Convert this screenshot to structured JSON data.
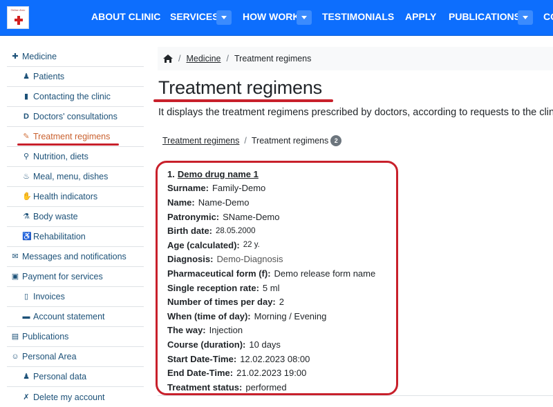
{
  "navbar": {
    "logo_text": "Online clinic",
    "items": [
      {
        "label": "ABOUT CLINIC",
        "has_dropdown": false
      },
      {
        "label": "SERVICES",
        "has_dropdown": true
      },
      {
        "label": "HOW WORK",
        "has_dropdown": true
      },
      {
        "label": "TESTIMONIALS",
        "has_dropdown": false
      },
      {
        "label": "APPLY",
        "has_dropdown": false
      },
      {
        "label": "PUBLICATIONS",
        "has_dropdown": true
      },
      {
        "label": "CO",
        "has_dropdown": false
      }
    ]
  },
  "sidebar": {
    "items": [
      {
        "label": "Medicine",
        "icon": "medkit-icon",
        "level": 1
      },
      {
        "label": "Patients",
        "icon": "user-doctor-icon",
        "level": 2
      },
      {
        "label": "Contacting the clinic",
        "icon": "file-medical-icon",
        "level": 2
      },
      {
        "label": "Doctors' consultations",
        "icon": "document-icon",
        "level": 2
      },
      {
        "label": "Treatment regimens",
        "icon": "syringe-icon",
        "level": 2,
        "active": true
      },
      {
        "label": "Nutrition, diets",
        "icon": "spoon-icon",
        "level": 2
      },
      {
        "label": "Meal, menu, dishes",
        "icon": "hotdish-icon",
        "level": 2
      },
      {
        "label": "Health indicators",
        "icon": "hand-icon",
        "level": 2
      },
      {
        "label": "Body waste",
        "icon": "flask-icon",
        "level": 2
      },
      {
        "label": "Rehabilitation",
        "icon": "person-cane-icon",
        "level": 2
      },
      {
        "label": "Messages and notifications",
        "icon": "envelope-icon",
        "level": 1
      },
      {
        "label": "Payment for services",
        "icon": "money-icon",
        "level": 1
      },
      {
        "label": "Invoices",
        "icon": "invoice-icon",
        "level": 2
      },
      {
        "label": "Account statement",
        "icon": "money-check-icon",
        "level": 2
      },
      {
        "label": "Publications",
        "icon": "file-pdf-icon",
        "level": 1
      },
      {
        "label": "Personal Area",
        "icon": "user-circle-icon",
        "level": 1
      },
      {
        "label": "Personal data",
        "icon": "user-check-icon",
        "level": 2
      },
      {
        "label": "Delete my account",
        "icon": "user-slash-icon",
        "level": 2
      }
    ]
  },
  "breadcrumb": {
    "home_icon": "home-icon",
    "items": [
      "Medicine",
      "Treatment regimens"
    ]
  },
  "page": {
    "title": "Treatment regimens",
    "description": "It displays the treatment regimens prescribed by doctors, according to requests to the clinic."
  },
  "sub_breadcrumb": {
    "link": "Treatment regimens",
    "current": "Treatment regimens",
    "count": "2"
  },
  "record": {
    "number": "1.",
    "drug_name": "Demo drug name 1",
    "fields": [
      {
        "label": "Surname:",
        "value": "Family-Demo"
      },
      {
        "label": "Name:",
        "value": "Name-Demo"
      },
      {
        "label": "Patronymic:",
        "value": "SName-Demo"
      },
      {
        "label": "Birth date:",
        "value": "28.05.2000"
      },
      {
        "label": "Age (calculated):",
        "value": "22 y."
      },
      {
        "label": "Diagnosis:",
        "value": "Demo-Diagnosis"
      },
      {
        "label": "Pharmaceutical form (f):",
        "value": "Demo release form name"
      },
      {
        "label": "Single reception rate:",
        "value": "5 ml"
      },
      {
        "label": "Number of times per day:",
        "value": "2"
      },
      {
        "label": "When (time of day):",
        "value": "Morning / Evening"
      },
      {
        "label": "The way:",
        "value": "Injection"
      },
      {
        "label": "Course (duration):",
        "value": "10 days"
      },
      {
        "label": "Start Date-Time:",
        "value": "12.02.2023 08:00"
      },
      {
        "label": "End Date-Time:",
        "value": "21.02.2023 19:00"
      },
      {
        "label": "Treatment status:",
        "value": "performed"
      }
    ]
  },
  "colors": {
    "navbar": "#0d6efd",
    "sidebar_text": "#1c5178",
    "active_item": "#c9602e",
    "highlight_red": "#c8202b",
    "badge": "#6c757d"
  }
}
